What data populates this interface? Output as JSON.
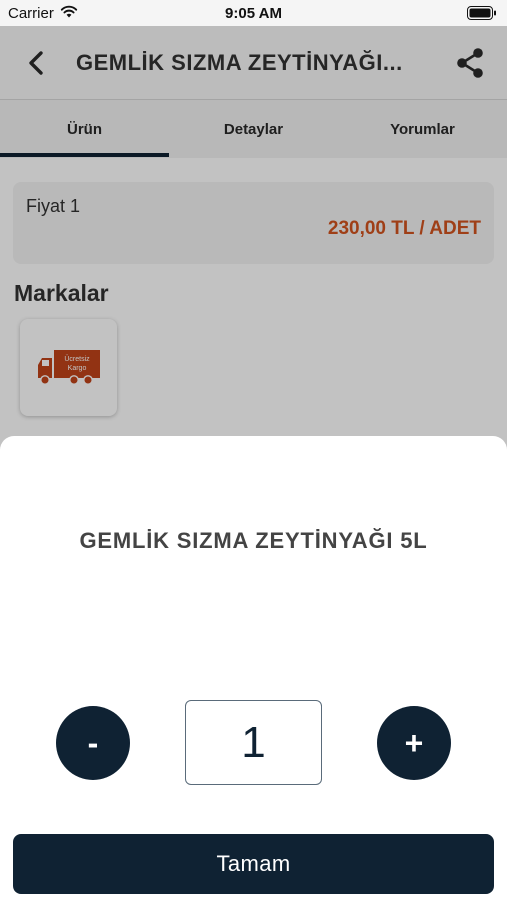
{
  "status_bar": {
    "carrier": "Carrier",
    "time": "9:05 AM",
    "icons": [
      "wifi-icon",
      "battery-icon"
    ]
  },
  "nav": {
    "title": "GEMLİK SIZMA ZEYTİNYAĞI...",
    "back_icon": "chevron-left-icon",
    "share_icon": "share-icon"
  },
  "tabs": [
    {
      "label": "Ürün",
      "active": true
    },
    {
      "label": "Detaylar",
      "active": false
    },
    {
      "label": "Yorumlar",
      "active": false
    }
  ],
  "price_card": {
    "label": "Fiyat 1",
    "value": "230,00 TL / ADET"
  },
  "brands": {
    "title": "Markalar",
    "items": [
      {
        "name": "Ücretsiz Kargo",
        "line1": "Ücretsiz",
        "line2": "Kargo",
        "icon": "delivery-truck-icon"
      }
    ]
  },
  "sheet": {
    "title": "GEMLİK SIZMA ZEYTİNYAĞI 5L",
    "minus_label": "-",
    "plus_label": "+",
    "quantity": "1",
    "confirm_label": "Tamam"
  },
  "colors": {
    "primary": "#0f2233",
    "price": "#d2531f",
    "truck": "#c0441a"
  }
}
